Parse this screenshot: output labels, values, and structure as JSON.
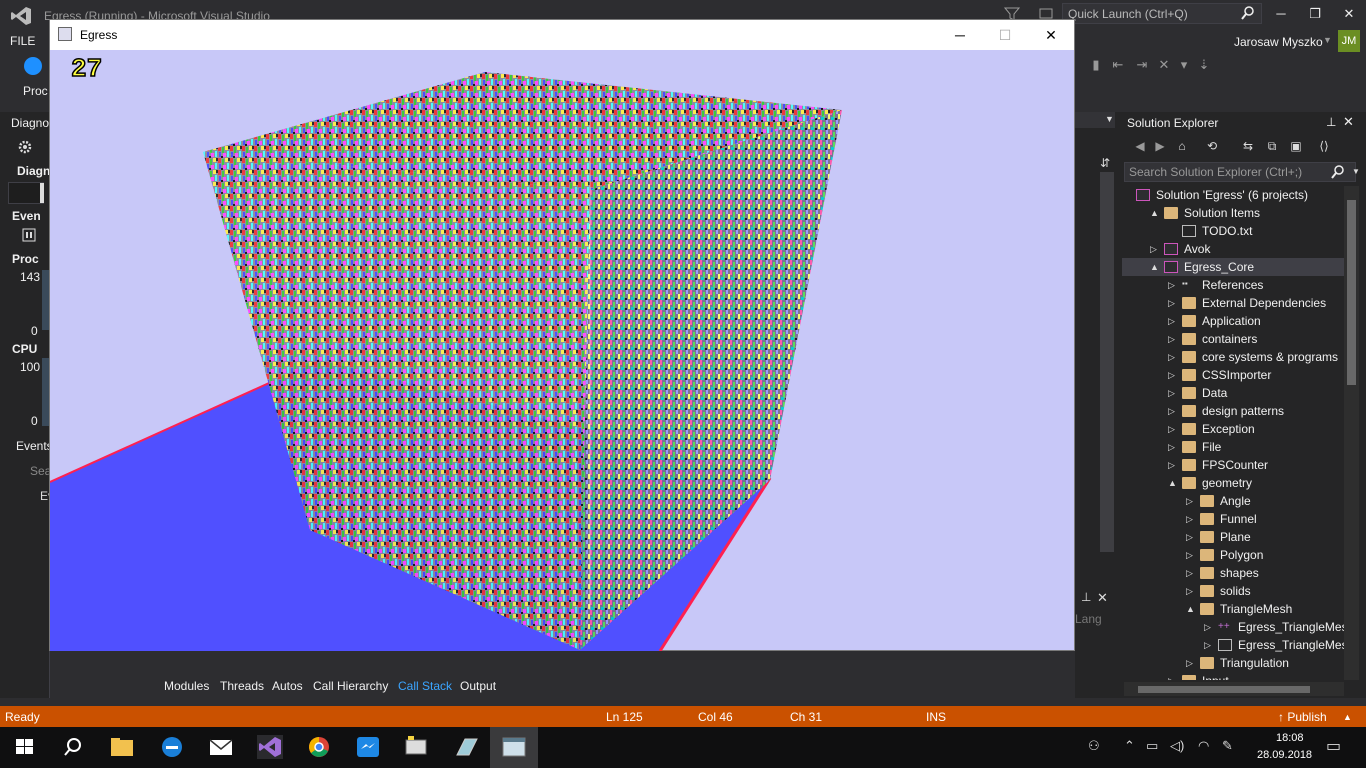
{
  "vs": {
    "title": "Egress (Running) - Microsoft Visual Studio",
    "quick_launch_placeholder": "Quick Launch (Ctrl+Q)",
    "menu_file": "FILE",
    "user": "Jarosaw Myszko",
    "avatar": "JM",
    "toolbar_process_label": "Proc",
    "window_controls": {
      "minimize": "─",
      "maximize": "❐",
      "close": "✕"
    }
  },
  "diagnostics": {
    "title": "Diagno",
    "tab": "Diagn",
    "events_header": "Even",
    "process_header": "Proc",
    "process_max": "143",
    "process_min": "0",
    "cpu_header": "CPU",
    "cpu_max": "100",
    "cpu_min": "0",
    "events_tab": "Events",
    "search_stub": "Sea",
    "events_column_stub": "Ev"
  },
  "egress": {
    "title": "Egress",
    "fps": "27",
    "controls": {
      "minimize": "─",
      "maximize": "☐",
      "close": "✕"
    }
  },
  "bottom_tabs": [
    {
      "label": "Modules",
      "active": false
    },
    {
      "label": "Threads",
      "active": false
    },
    {
      "label": "Autos",
      "active": false
    },
    {
      "label": "Call Hierarchy",
      "active": false
    },
    {
      "label": "Call Stack",
      "active": true
    },
    {
      "label": "Output",
      "active": false
    }
  ],
  "behind_pane_text": "Lang",
  "solution_explorer": {
    "title": "Solution Explorer",
    "search_placeholder": "Search Solution Explorer (Ctrl+;)",
    "tree": [
      {
        "label": "Solution 'Egress' (6 projects)",
        "depth": 0,
        "arrow": "",
        "icon": "solution"
      },
      {
        "label": "Solution Items",
        "depth": 1,
        "arrow": "▲",
        "icon": "folder"
      },
      {
        "label": "TODO.txt",
        "depth": 2,
        "arrow": "",
        "icon": "file"
      },
      {
        "label": "Avok",
        "depth": 1,
        "arrow": "▷",
        "icon": "project"
      },
      {
        "label": "Egress_Core",
        "depth": 1,
        "arrow": "▲",
        "icon": "project",
        "selected": true
      },
      {
        "label": "References",
        "depth": 2,
        "arrow": "▷",
        "icon": "refs"
      },
      {
        "label": "External Dependencies",
        "depth": 2,
        "arrow": "▷",
        "icon": "folder"
      },
      {
        "label": "Application",
        "depth": 2,
        "arrow": "▷",
        "icon": "folder"
      },
      {
        "label": "containers",
        "depth": 2,
        "arrow": "▷",
        "icon": "folder"
      },
      {
        "label": "core systems & programs",
        "depth": 2,
        "arrow": "▷",
        "icon": "folder"
      },
      {
        "label": "CSSImporter",
        "depth": 2,
        "arrow": "▷",
        "icon": "folder"
      },
      {
        "label": "Data",
        "depth": 2,
        "arrow": "▷",
        "icon": "folder"
      },
      {
        "label": "design patterns",
        "depth": 2,
        "arrow": "▷",
        "icon": "folder"
      },
      {
        "label": "Exception",
        "depth": 2,
        "arrow": "▷",
        "icon": "folder"
      },
      {
        "label": "File",
        "depth": 2,
        "arrow": "▷",
        "icon": "folder"
      },
      {
        "label": "FPSCounter",
        "depth": 2,
        "arrow": "▷",
        "icon": "folder"
      },
      {
        "label": "geometry",
        "depth": 2,
        "arrow": "▲",
        "icon": "folder"
      },
      {
        "label": "Angle",
        "depth": 3,
        "arrow": "▷",
        "icon": "folder"
      },
      {
        "label": "Funnel",
        "depth": 3,
        "arrow": "▷",
        "icon": "folder"
      },
      {
        "label": "Plane",
        "depth": 3,
        "arrow": "▷",
        "icon": "folder"
      },
      {
        "label": "Polygon",
        "depth": 3,
        "arrow": "▷",
        "icon": "folder"
      },
      {
        "label": "shapes",
        "depth": 3,
        "arrow": "▷",
        "icon": "folder"
      },
      {
        "label": "solids",
        "depth": 3,
        "arrow": "▷",
        "icon": "folder"
      },
      {
        "label": "TriangleMesh",
        "depth": 3,
        "arrow": "▲",
        "icon": "folder"
      },
      {
        "label": "Egress_TriangleMesh.c",
        "depth": 4,
        "arrow": "▷",
        "icon": "cpp"
      },
      {
        "label": "Egress_TriangleMesh.h",
        "depth": 4,
        "arrow": "▷",
        "icon": "file"
      },
      {
        "label": "Triangulation",
        "depth": 3,
        "arrow": "▷",
        "icon": "folder"
      },
      {
        "label": "Input",
        "depth": 2,
        "arrow": "▷",
        "icon": "folder"
      }
    ]
  },
  "status": {
    "state": "Ready",
    "line": "Ln 125",
    "col": "Col 46",
    "ch": "Ch 31",
    "mode": "INS",
    "publish": "↑ Publish",
    "publish_chevron": "▲"
  },
  "taskbar": {
    "time": "18:08",
    "date": "28.09.2018"
  },
  "colors": {
    "status_bar": "#ca5100",
    "scene_background": "#c8c8f8",
    "floor": "#5050ff",
    "floor_edge": "#ff2050",
    "active_tab": "#3ba5ff"
  }
}
